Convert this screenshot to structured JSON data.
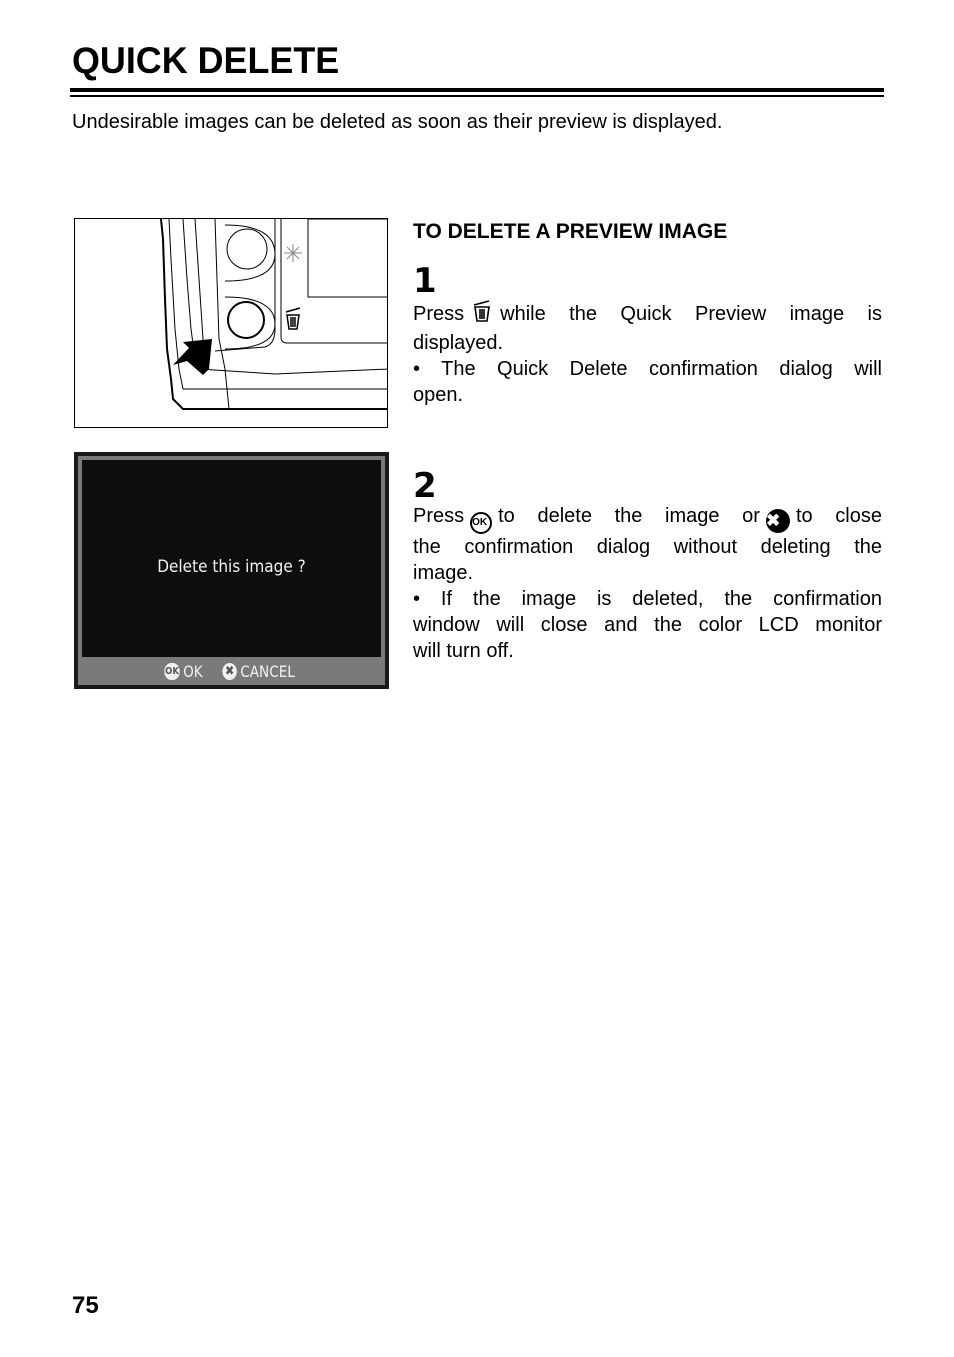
{
  "page": {
    "title": "QUICK DELETE",
    "intro": "Undesirable images can be deleted as soon as their preview is displayed.",
    "page_number": "75"
  },
  "section": {
    "heading": "TO DELETE A PREVIEW IMAGE",
    "steps": [
      {
        "number": "1",
        "icon": "trash-icon",
        "text_before_icon": "Press",
        "text_after_icon_line1": "while the Quick Preview image is",
        "text_line2": "displayed.",
        "bullet_line1": "• The Quick Delete confirmation dialog will",
        "bullet_line2": "open."
      },
      {
        "number": "2",
        "icon_ok": "ok-button-icon",
        "icon_cancel": "cancel-x-icon",
        "text_before_ok": "Press",
        "ok_glyph": "OK",
        "text_between": "to delete the image or",
        "cancel_glyph": "✖",
        "text_after_cancel": "to close",
        "line2": "the confirmation dialog without deleting the",
        "line3": "image.",
        "bullet_line1": "• If the image is deleted, the confirmation",
        "bullet_line2": "window will close and the color LCD monitor",
        "bullet_line3": "will turn off."
      }
    ]
  },
  "figures": {
    "camera_illustration": {
      "description": "camera back with trash button and pointing arrow",
      "icons": [
        "sparkle-icon",
        "trash-icon",
        "arrow-icon"
      ]
    },
    "lcd_dialog": {
      "message": "Delete this image ?",
      "ok_icon_label": "OK",
      "ok_label": "OK",
      "cancel_icon_label": "✖",
      "cancel_label": "CANCEL"
    }
  }
}
